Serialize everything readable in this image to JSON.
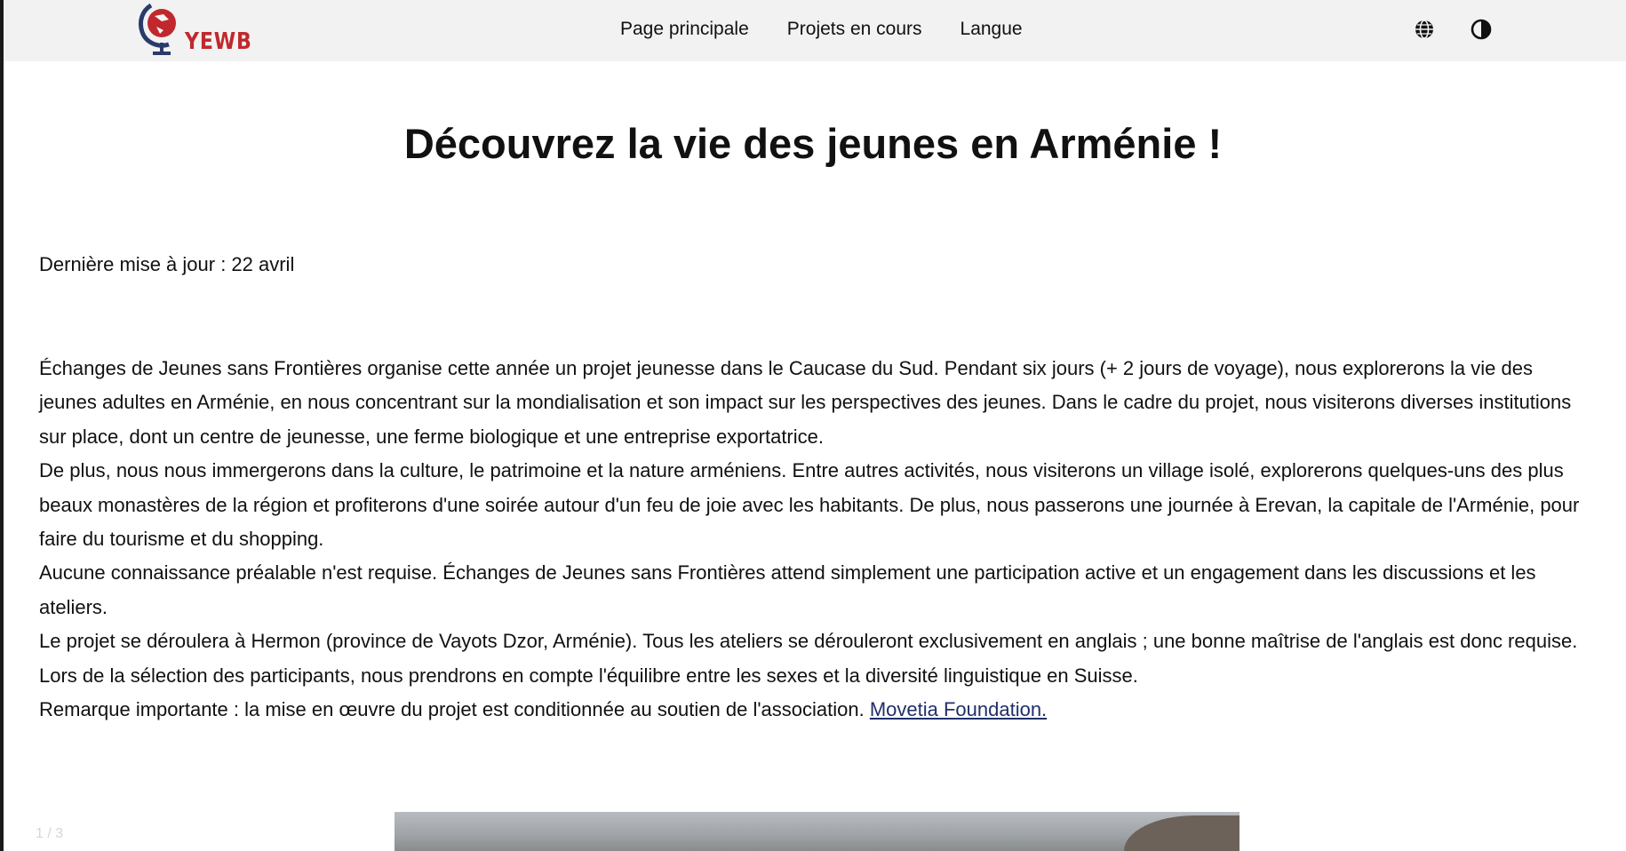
{
  "brand": {
    "logo_text": "YEWB"
  },
  "nav": {
    "links": [
      {
        "label": "Page principale"
      },
      {
        "label": "Projets en cours"
      },
      {
        "label": "Langue"
      }
    ],
    "icons": [
      "globe-icon",
      "contrast-icon"
    ]
  },
  "page": {
    "title": "Découvrez la vie des jeunes en Arménie !",
    "last_update": "Dernière mise à jour : 22 avril",
    "paragraphs": [
      "Échanges de Jeunes sans Frontières organise cette année un projet jeunesse dans le Caucase du Sud. Pendant six jours (+ 2 jours de voyage), nous explorerons la vie des jeunes adultes en Arménie, en nous concentrant sur la mondialisation et son impact sur les perspectives des jeunes. Dans le cadre du projet, nous visiterons diverses institutions sur place, dont un centre de jeunesse, une ferme biologique et une entreprise exportatrice.",
      "De plus, nous nous immergerons dans la culture, le patrimoine et la nature arméniens. Entre autres activités, nous visiterons un village isolé, explorerons quelques-uns des plus beaux monastères de la région et profiterons d'une soirée autour d'un feu de joie avec les habitants. De plus, nous passerons une journée à Erevan, la capitale de l'Arménie, pour faire du tourisme et du shopping.",
      "Aucune connaissance préalable n'est requise. Échanges de Jeunes sans Frontières attend simplement une participation active et un engagement dans les discussions et les ateliers.",
      "Le projet se déroulera à Hermon (province de Vayots Dzor, Arménie). Tous les ateliers se dérouleront exclusivement en anglais ; une bonne maîtrise de l'anglais est donc requise. Lors de la sélection des participants, nous prendrons en compte l'équilibre entre les sexes et la diversité linguistique en Suisse."
    ],
    "remark_text": "Remarque importante : la mise en œuvre du projet est conditionnée au soutien de l'association. ",
    "remark_link": "Movetia Foundation."
  },
  "carousel": {
    "counter": "1 / 3"
  },
  "colors": {
    "navbar_bg": "#f2f2f2",
    "brand_red": "#c0282d",
    "link": "#1f2f6b"
  }
}
